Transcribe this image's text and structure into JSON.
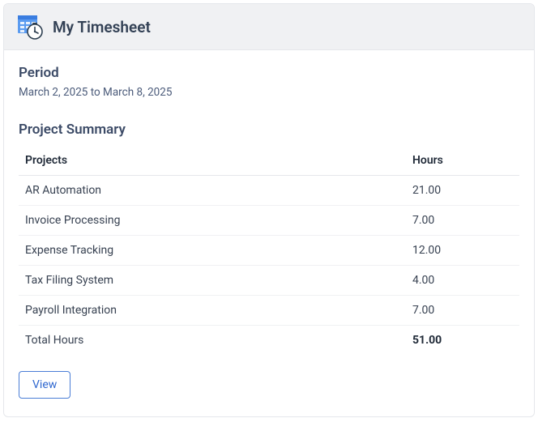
{
  "header": {
    "title": "My Timesheet"
  },
  "period": {
    "label": "Period",
    "range": "March 2, 2025 to March 8, 2025"
  },
  "summary": {
    "title": "Project Summary",
    "columns": {
      "project": "Projects",
      "hours": "Hours"
    },
    "rows": [
      {
        "project": "AR Automation",
        "hours": "21.00"
      },
      {
        "project": "Invoice Processing",
        "hours": "7.00"
      },
      {
        "project": "Expense Tracking",
        "hours": "12.00"
      },
      {
        "project": "Tax Filing System",
        "hours": "4.00"
      },
      {
        "project": "Payroll Integration",
        "hours": "7.00"
      }
    ],
    "total": {
      "label": "Total Hours",
      "hours": "51.00"
    }
  },
  "actions": {
    "view": "View"
  }
}
